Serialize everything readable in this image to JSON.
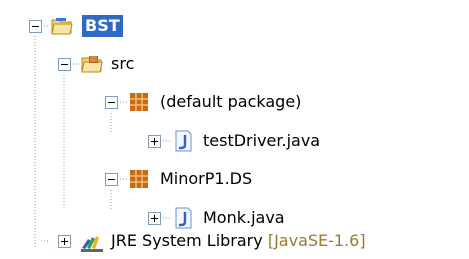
{
  "tree": {
    "root": {
      "label": "BST",
      "icon": "project-folder-icon",
      "expanded": true,
      "selected": true
    },
    "src": {
      "label": "src",
      "icon": "source-folder-icon",
      "expanded": true
    },
    "default_package": {
      "label": "(default package)",
      "icon": "package-icon",
      "expanded": true
    },
    "test_driver": {
      "label": "testDriver.java",
      "icon": "java-file-icon",
      "expanded": false
    },
    "minor_package": {
      "label": "MinorP1.DS",
      "icon": "package-icon",
      "expanded": true
    },
    "monk": {
      "label": "Monk.java",
      "icon": "java-file-icon",
      "expanded": false
    },
    "jre": {
      "label": "JRE System Library",
      "decoration": "[JavaSE-1.6]",
      "icon": "library-icon",
      "expanded": false
    }
  },
  "colors": {
    "selection": "#316ac5",
    "tree_lines": "#9a9a9a",
    "decoration_text": "#9a7a32"
  }
}
